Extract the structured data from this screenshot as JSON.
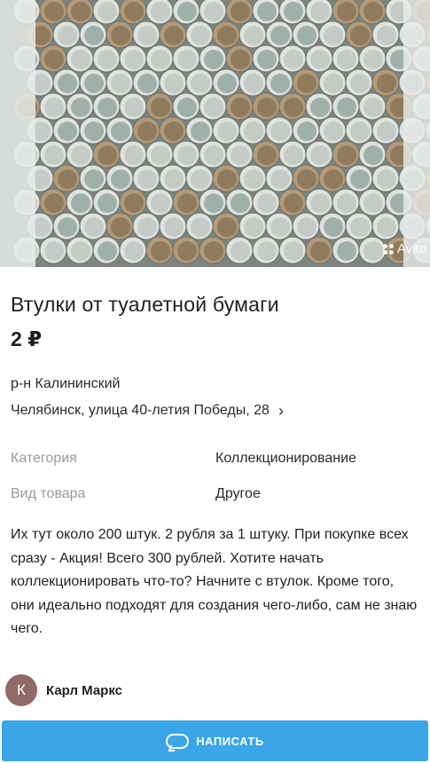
{
  "listing": {
    "watermark": "Avito",
    "title": "Втулки от туалетной бумаги",
    "price": "2 ₽",
    "district": "р-н Калининский",
    "address": "Челябинск, улица 40-летия Победы, 28",
    "params": [
      {
        "label": "Категория",
        "value": "Коллекционирование"
      },
      {
        "label": "Вид товара",
        "value": "Другое"
      }
    ],
    "description": "Их тут около 200 штук. 2 рубля за 1 штуку. При покупке всех сразу - Акция! Всего 300 рублей. Хотите начать коллекционировать что-то? Начните с втулок. Кроме того, они идеально подходят для создания чего-либо, сам не знаю чего."
  },
  "seller": {
    "initial": "К",
    "name": "Карл Маркс"
  },
  "actions": {
    "write_label": "НАПИСАТЬ"
  },
  "icons": {
    "address_chevron": "chevron-right-icon",
    "write": "chat-bubble-icon"
  },
  "colors": {
    "button": "#3aa6e8",
    "avatar": "#8f6a66",
    "muted_label": "#9a9a9a"
  }
}
